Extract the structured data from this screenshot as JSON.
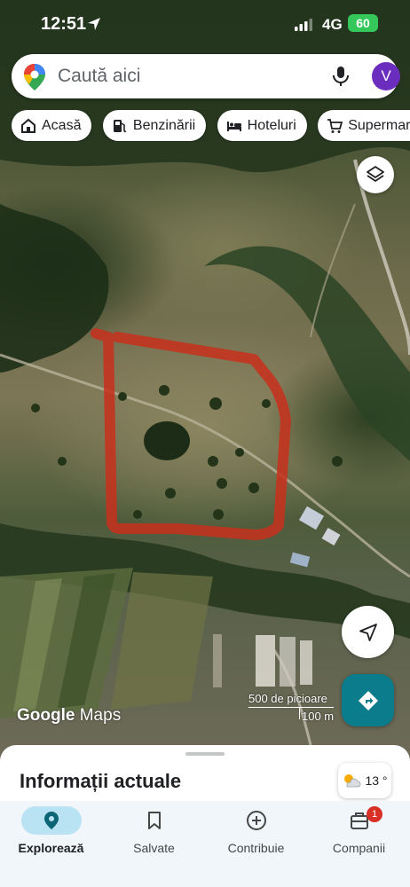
{
  "status_bar": {
    "time": "12:51",
    "network": "4G",
    "battery": "60"
  },
  "search": {
    "placeholder": "Caută aici",
    "avatar_letter": "V"
  },
  "chips": [
    {
      "label": "Acasă",
      "icon": "home-icon"
    },
    {
      "label": "Benzinării",
      "icon": "gas-station-icon"
    },
    {
      "label": "Hoteluri",
      "icon": "bed-icon"
    },
    {
      "label": "Supermarke",
      "icon": "cart-icon"
    }
  ],
  "map": {
    "attribution": {
      "brand": "Google",
      "product": "Maps"
    },
    "scale": {
      "imperial": "500 de picioare",
      "metric": "100 m"
    },
    "boundary_color": "#c8301c"
  },
  "sheet": {
    "title": "Informații actuale"
  },
  "weather": {
    "temperature": "13 °"
  },
  "bottom_nav": [
    {
      "label": "Explorează",
      "icon": "explore-pin-icon",
      "active": true
    },
    {
      "label": "Salvate",
      "icon": "bookmark-icon",
      "active": false
    },
    {
      "label": "Contribuie",
      "icon": "add-circle-icon",
      "active": false
    },
    {
      "label": "Companii",
      "icon": "store-icon",
      "active": false,
      "badge": "1"
    }
  ],
  "colors": {
    "accent": "#0b7c8c",
    "avatar": "#6b2dbd",
    "active_tab": "#b9e3f2",
    "badge": "#d93025"
  }
}
